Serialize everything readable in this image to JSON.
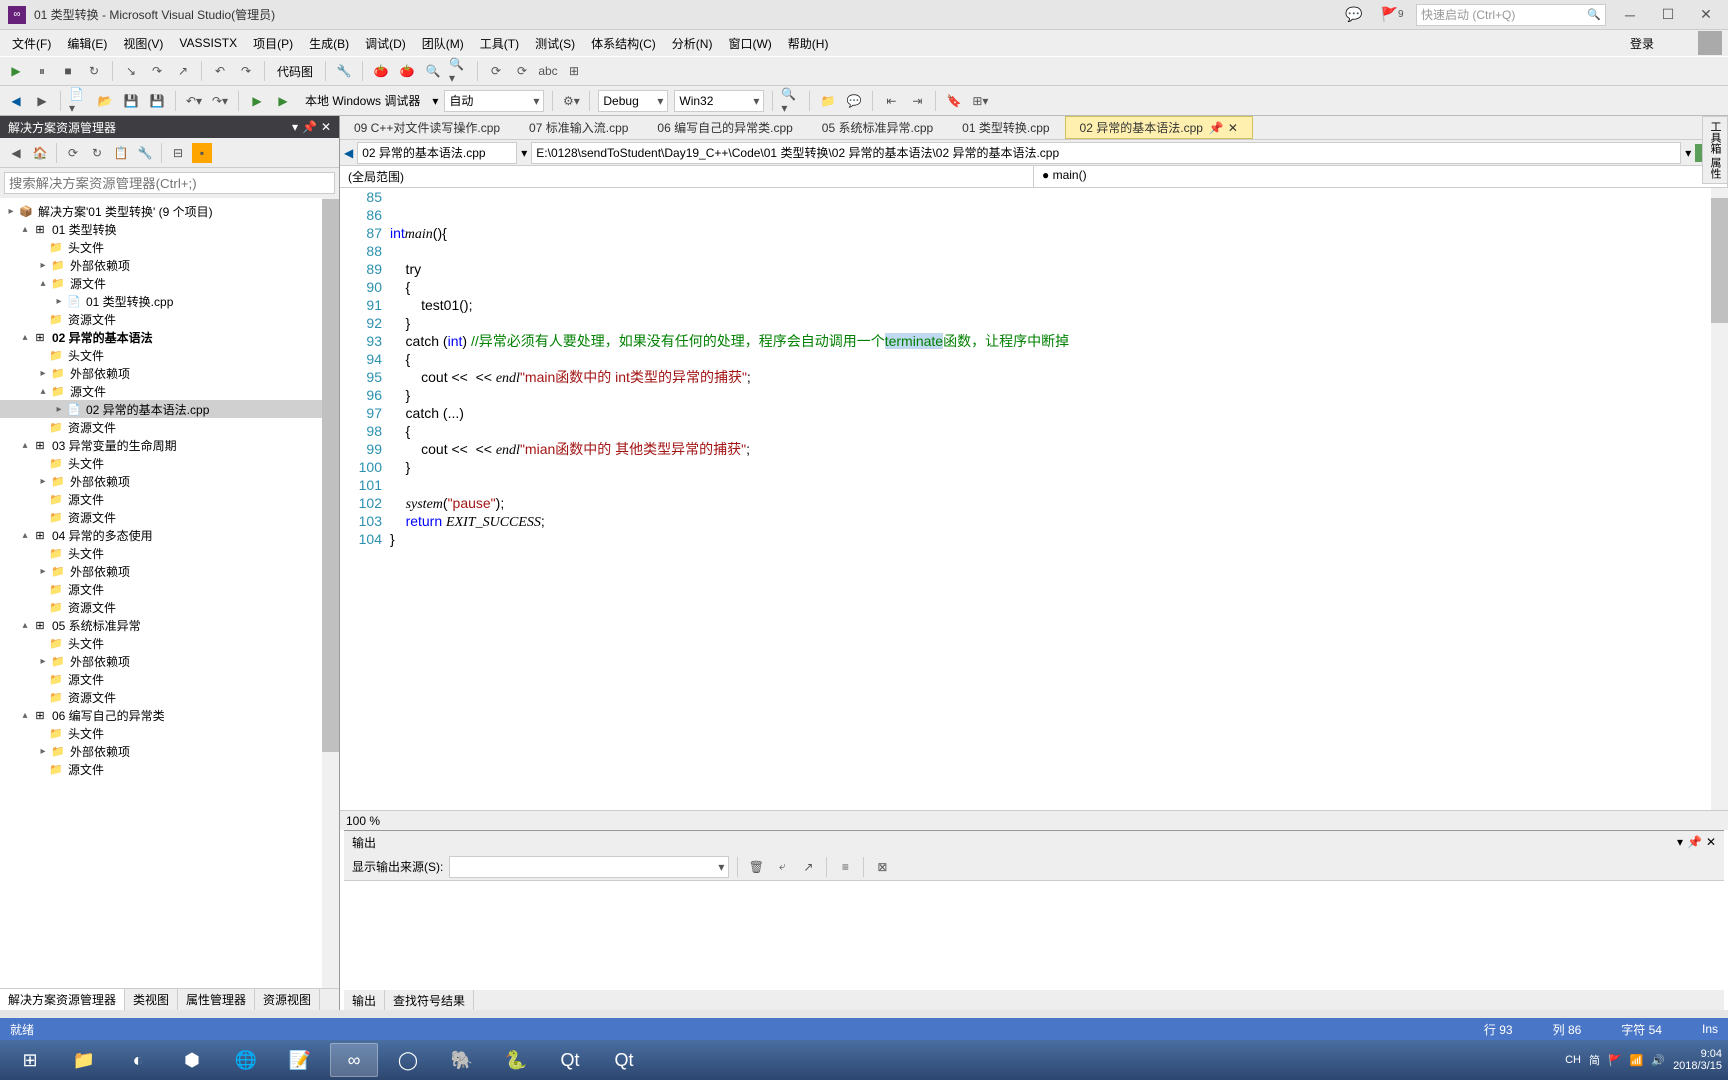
{
  "title": "01 类型转换 - Microsoft Visual Studio(管理员)",
  "notif_count": "9",
  "quicklaunch_ph": "快速启动 (Ctrl+Q)",
  "menu": [
    "文件(F)",
    "编辑(E)",
    "视图(V)",
    "VASSISTX",
    "项目(P)",
    "生成(B)",
    "调试(D)",
    "团队(M)",
    "工具(T)",
    "测试(S)",
    "体系结构(C)",
    "分析(N)",
    "窗口(W)",
    "帮助(H)"
  ],
  "login": "登录",
  "tb": {
    "codemap": "代码图",
    "debugger": "本地 Windows 调试器",
    "auto": "自动",
    "config": "Debug",
    "platform": "Win32"
  },
  "sol": {
    "panel_title": "解决方案资源管理器",
    "search_ph": "搜索解决方案资源管理器(Ctrl+;)",
    "root": "解决方案'01 类型转换' (9 个项目)",
    "tabs": [
      "解决方案资源管理器",
      "类视图",
      "属性管理器",
      "资源视图"
    ],
    "projects": [
      {
        "name": "01 类型转换",
        "src_file": "01 类型转换.cpp"
      },
      {
        "name": "02 异常的基本语法",
        "src_file": "02 异常的基本语法.cpp",
        "bold": true,
        "active": true
      },
      {
        "name": "03 异常变量的生命周期"
      },
      {
        "name": "04 异常的多态使用"
      },
      {
        "name": "05 系统标准异常"
      },
      {
        "name": "06 编写自己的异常类"
      }
    ],
    "folders": {
      "hdr": "头文件",
      "ext": "外部依赖项",
      "src": "源文件",
      "res": "资源文件"
    }
  },
  "tabs": [
    {
      "label": "09 C++对文件读写操作.cpp"
    },
    {
      "label": "07 标准输入流.cpp"
    },
    {
      "label": "06 编写自己的异常类.cpp"
    },
    {
      "label": "05 系统标准异常.cpp"
    },
    {
      "label": "01 类型转换.cpp"
    },
    {
      "label": "02 异常的基本语法.cpp",
      "active": true
    }
  ],
  "nav": {
    "combo": "02 异常的基本语法.cpp",
    "path": "E:\\0128\\sendToStudent\\Day19_C++\\Code\\01 类型转换\\02 异常的基本语法\\02 异常的基本语法.cpp",
    "go": "Go",
    "scope_l": "(全局范围)",
    "scope_r": "main()"
  },
  "code": {
    "start": 85,
    "lines": [
      "",
      "",
      {
        "kw": "int",
        "fn": "main",
        "rest": "(){"
      },
      "",
      "    try",
      "    {",
      "        test01();",
      "    }",
      {
        "pre": "    catch (",
        "kw": "int",
        "post": ") ",
        "cm": "//异常必须有人要处理，如果没有任何的处理，程序会自动调用一个",
        "hl": "terminate",
        "cm2": "函数，让程序中断掉"
      },
      "    {",
      {
        "pre": "        cout << ",
        "str": "\"main函数中的 int类型的异常的捕获\"",
        "post": " << ",
        "fn": "endl",
        "end": ";"
      },
      "    }",
      "    catch (...)",
      "    {",
      {
        "pre": "        cout << ",
        "str": "\"mian函数中的 其他类型异常的捕获\"",
        "post": " << ",
        "fn": "endl",
        "end": ";"
      },
      "    }",
      "",
      {
        "pre": "    ",
        "fn": "system",
        "mid": "(",
        "str": "\"pause\"",
        "end": ");"
      },
      {
        "pre": "    ",
        "kw": "return",
        "post": " ",
        "fn": "EXIT_SUCCESS",
        "end": ";"
      },
      "}"
    ],
    "zoom": "100 %"
  },
  "output": {
    "title": "输出",
    "src_label": "显示输出来源(S):",
    "tabs": [
      "输出",
      "查找符号结果"
    ]
  },
  "status": {
    "ready": "就绪",
    "line": "行 93",
    "col": "列 86",
    "char": "字符 54",
    "ins": "Ins"
  },
  "tray": {
    "ime": "CH",
    "kb": "简",
    "time": "9:04",
    "date": "2018/3/15"
  },
  "sidetab": "工具箱 属性"
}
